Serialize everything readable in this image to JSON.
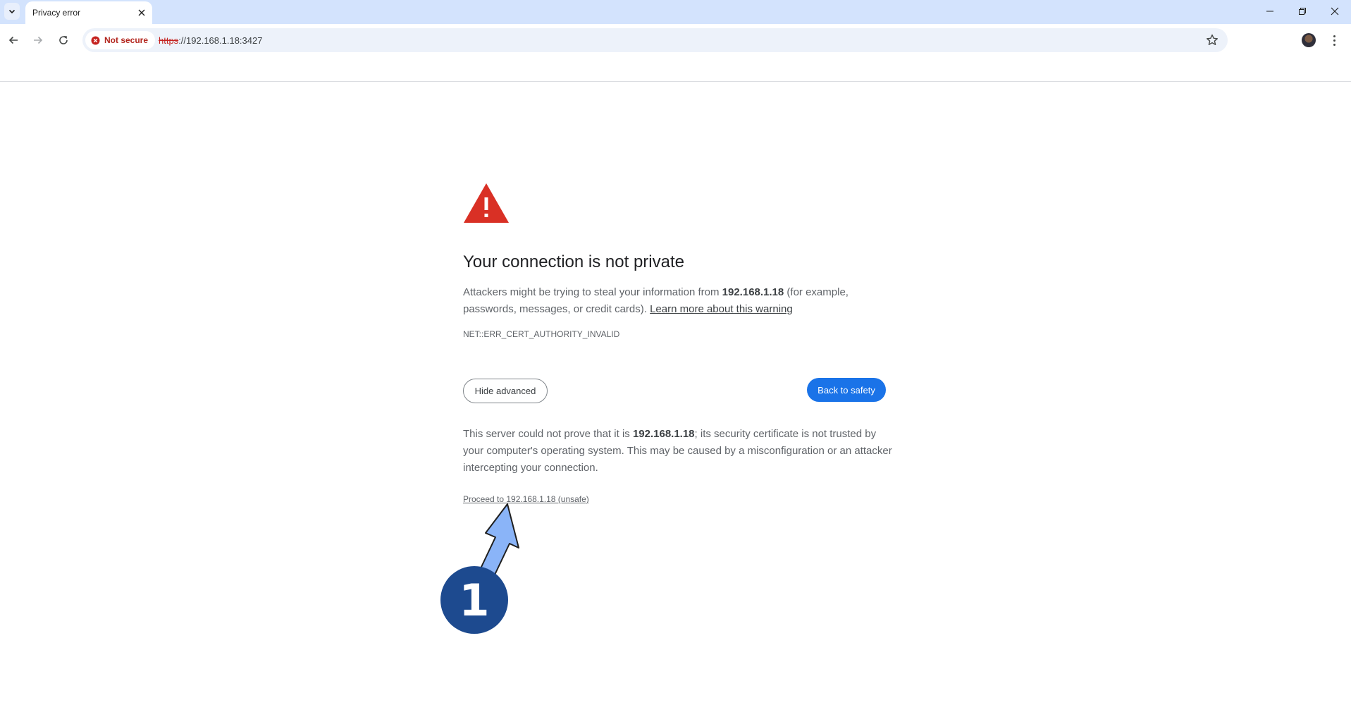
{
  "browser": {
    "tab": {
      "title": "Privacy error"
    },
    "toolbar": {
      "security_chip": "Not secure",
      "url_scheme": "https",
      "url_rest": "://192.168.1.18:3427"
    }
  },
  "page": {
    "heading": "Your connection is not private",
    "intro_before": "Attackers might be trying to steal your information from ",
    "host": "192.168.1.18",
    "intro_after": " (for example, passwords, messages, or credit cards). ",
    "learn_more": "Learn more about this warning",
    "error_code": "NET::ERR_CERT_AUTHORITY_INVALID",
    "hide_advanced": "Hide advanced",
    "back_to_safety": "Back to safety",
    "details_before": "This server could not prove that it is ",
    "details_after": "; its security certificate is not trusted by your computer's operating system. This may be caused by a misconfiguration or an attacker intercepting your connection.",
    "proceed_link": "Proceed to 192.168.1.18 (unsafe)"
  },
  "annotation": {
    "step_number": "1",
    "arrow_color": "#8ab4f8",
    "badge_color": "#1d4a8f"
  },
  "colors": {
    "accent": "#1a73e8",
    "warning": "#d93025",
    "tabstrip": "#d3e3fd"
  }
}
